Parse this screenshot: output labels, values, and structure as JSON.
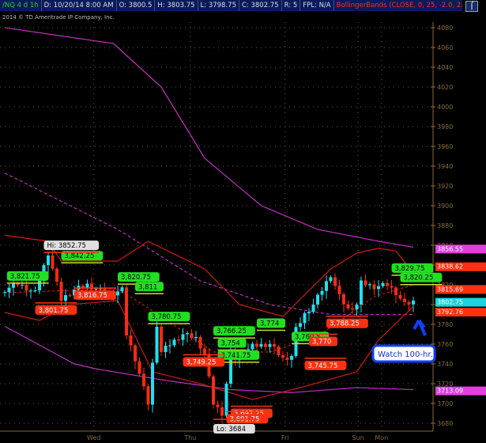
{
  "header": {
    "symbol": "/NQ 4 d 1h",
    "date": "D: 10/20/14 8:00 AM",
    "open": "O: 3800.5",
    "high": "H: 3803.75",
    "low": "L: 3798.75",
    "close": "C: 3802.75",
    "range": "R: 5",
    "fpl": "FPL: N/A",
    "study": "BollingerBands (CLOSE, 0, 25, -2.0, 2.0,..."
  },
  "copyright": "2014 © TD Ameritrade IP Company, Inc.",
  "chart_data": {
    "type": "candlestick",
    "ylim": [
      3670,
      4085
    ],
    "yticks": [
      4080,
      4060,
      4040,
      4020,
      4000,
      3980,
      3960,
      3940,
      3920,
      3900,
      3880,
      3860,
      3840,
      3820,
      3800,
      3780,
      3760,
      3740,
      3720,
      3700,
      3680
    ],
    "xticks": [
      {
        "label": "Wed",
        "i": 20.5
      },
      {
        "label": "Thu",
        "i": 42.7
      },
      {
        "label": "Fri",
        "i": 64.5
      },
      {
        "label": "Sun",
        "i": 81.3
      },
      {
        "label": "Mon",
        "i": 86.7
      }
    ],
    "candles_count": 95,
    "close_path": [
      [
        0,
        3815
      ],
      [
        3,
        3821
      ],
      [
        7,
        3812
      ],
      [
        10,
        3852
      ],
      [
        13,
        3805
      ],
      [
        16,
        3815
      ],
      [
        19,
        3820
      ],
      [
        24,
        3810
      ],
      [
        27,
        3815
      ],
      [
        28,
        3770
      ],
      [
        30,
        3745
      ],
      [
        33,
        3700
      ],
      [
        35,
        3780
      ],
      [
        36,
        3752
      ],
      [
        38,
        3760
      ],
      [
        41,
        3770
      ],
      [
        44,
        3766
      ],
      [
        46,
        3750
      ],
      [
        48,
        3700
      ],
      [
        50,
        3690
      ],
      [
        52,
        3750
      ],
      [
        53,
        3745
      ],
      [
        57,
        3758
      ],
      [
        61,
        3760
      ],
      [
        64,
        3745
      ],
      [
        66,
        3748
      ],
      [
        67,
        3775
      ],
      [
        69,
        3790
      ],
      [
        71,
        3800
      ],
      [
        75,
        3830
      ],
      [
        77,
        3808
      ],
      [
        79,
        3795
      ],
      [
        81,
        3800
      ],
      [
        82,
        3822
      ],
      [
        85,
        3818
      ],
      [
        88,
        3820
      ],
      [
        90,
        3812
      ],
      [
        92,
        3800
      ],
      [
        94,
        3802.75
      ]
    ],
    "upper_ma_band": [
      [
        0,
        4080
      ],
      [
        25,
        4064
      ],
      [
        36,
        4020
      ],
      [
        46,
        3948
      ],
      [
        59,
        3900
      ],
      [
        72,
        3876
      ],
      [
        86,
        3864
      ],
      [
        94,
        3858
      ]
    ],
    "mid_ma_dashed": [
      [
        0,
        3933
      ],
      [
        26,
        3876
      ],
      [
        45,
        3824
      ],
      [
        61,
        3800
      ],
      [
        75,
        3790
      ],
      [
        94,
        3790
      ]
    ],
    "lower_ma_band": [
      [
        0,
        3778
      ],
      [
        16,
        3740
      ],
      [
        21,
        3735
      ],
      [
        36,
        3724
      ],
      [
        52,
        3714
      ],
      [
        66,
        3711
      ],
      [
        81,
        3716
      ],
      [
        94,
        3714
      ]
    ],
    "bb_upper": [
      [
        0,
        3870
      ],
      [
        10,
        3864
      ],
      [
        13,
        3844
      ],
      [
        26,
        3844
      ],
      [
        33,
        3864
      ],
      [
        46,
        3836
      ],
      [
        54,
        3800
      ],
      [
        64,
        3788
      ],
      [
        75,
        3836
      ],
      [
        81,
        3852
      ],
      [
        86,
        3857
      ],
      [
        90,
        3854
      ],
      [
        94,
        3832
      ]
    ],
    "bb_lower": [
      [
        0,
        3792
      ],
      [
        8,
        3784
      ],
      [
        15,
        3800
      ],
      [
        26,
        3804
      ],
      [
        34,
        3732
      ],
      [
        45,
        3720
      ],
      [
        57,
        3704
      ],
      [
        68,
        3716
      ],
      [
        81,
        3732
      ],
      [
        86,
        3764
      ],
      [
        94,
        3798
      ]
    ],
    "bb_mid": [
      [
        0,
        3812
      ],
      [
        26,
        3816
      ],
      [
        36,
        3788
      ],
      [
        48,
        3752
      ],
      [
        61,
        3752
      ],
      [
        72,
        3768
      ],
      [
        85,
        3808
      ],
      [
        94,
        3820
      ]
    ],
    "high_labels": [
      {
        "text": "3,821.75",
        "i": 0.5,
        "v": 3821.75
      },
      {
        "text": "3,842.25",
        "i": 13,
        "v": 3842.25
      },
      {
        "text": "3,820.75",
        "i": 26,
        "v": 3820.75
      },
      {
        "text": "3,811",
        "i": 30,
        "v": 3811
      },
      {
        "text": "3,780.75",
        "i": 33,
        "v": 3780.75
      },
      {
        "text": "3,766.25",
        "i": 48,
        "v": 3766.25
      },
      {
        "text": "3,754",
        "i": 49,
        "v": 3754
      },
      {
        "text": "3,741.75",
        "i": 49,
        "v": 3741.75
      },
      {
        "text": "3,774",
        "i": 58,
        "v": 3774
      },
      {
        "text": "3,760.5",
        "i": 66,
        "v": 3760.5
      },
      {
        "text": "3,829.75",
        "i": 89,
        "v": 3829.75
      },
      {
        "text": "3,820.25",
        "i": 91,
        "v": 3820.25
      }
    ],
    "low_labels": [
      {
        "text": "3,801.75",
        "i": 7,
        "v": 3801.75
      },
      {
        "text": "3,816.75",
        "i": 16,
        "v": 3816.75
      },
      {
        "text": "3,749.25",
        "i": 41,
        "v": 3749.25
      },
      {
        "text": "3,697.25",
        "i": 52,
        "v": 3697.25
      },
      {
        "text": "3,691.75",
        "i": 51,
        "v": 3691.75
      },
      {
        "text": "3,745.75",
        "i": 69,
        "v": 3745.75
      },
      {
        "text": "3,770",
        "i": 70,
        "v": 3770
      },
      {
        "text": "3,788.25",
        "i": 74,
        "v": 3788.25
      }
    ],
    "extremes": [
      {
        "text": "Hi: 3852.75",
        "i": 9,
        "v": 3852.75
      },
      {
        "text": "Lo: 3684",
        "i": 48,
        "v": 3684
      }
    ],
    "axis_badges": [
      {
        "text": "3856.55",
        "v": 3856.55,
        "color": "#e040e0"
      },
      {
        "text": "3838.62",
        "v": 3838.62,
        "color": "#ff3010"
      },
      {
        "text": "3815.69",
        "v": 3815.69,
        "color": "#ff3010"
      },
      {
        "text": "3802.75",
        "v": 3802.75,
        "color": "#20d0e0"
      },
      {
        "text": "3792.76",
        "v": 3792.76,
        "color": "#ff3010"
      },
      {
        "text": "3713.09",
        "v": 3713.09,
        "color": "#e040e0"
      }
    ],
    "annotation": "Watch 100-hr."
  },
  "colors": {
    "up": "#20e0f0",
    "down": "#ff2a10",
    "ma": "#c030c0",
    "bb": "#d01a10",
    "axis": "#8a6a3a",
    "green_label": "#20e020",
    "red_label": "#ff3010"
  }
}
